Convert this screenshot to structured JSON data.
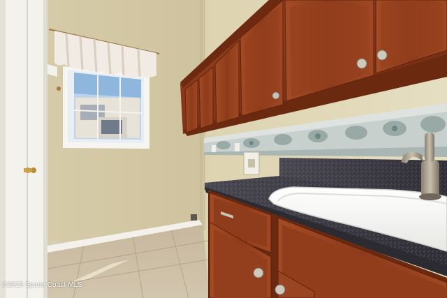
{
  "photo": {
    "subject": "laundry-room-with-cabinets-and-sink",
    "colors": {
      "wall": "#d9cfad",
      "cabinet": "#8b3a1c",
      "granite": "#3f3d45",
      "tile": "#c9bca5",
      "trim": "#f2f0ea"
    }
  },
  "watermark": {
    "text": "©2025 Space Coast MLS"
  }
}
